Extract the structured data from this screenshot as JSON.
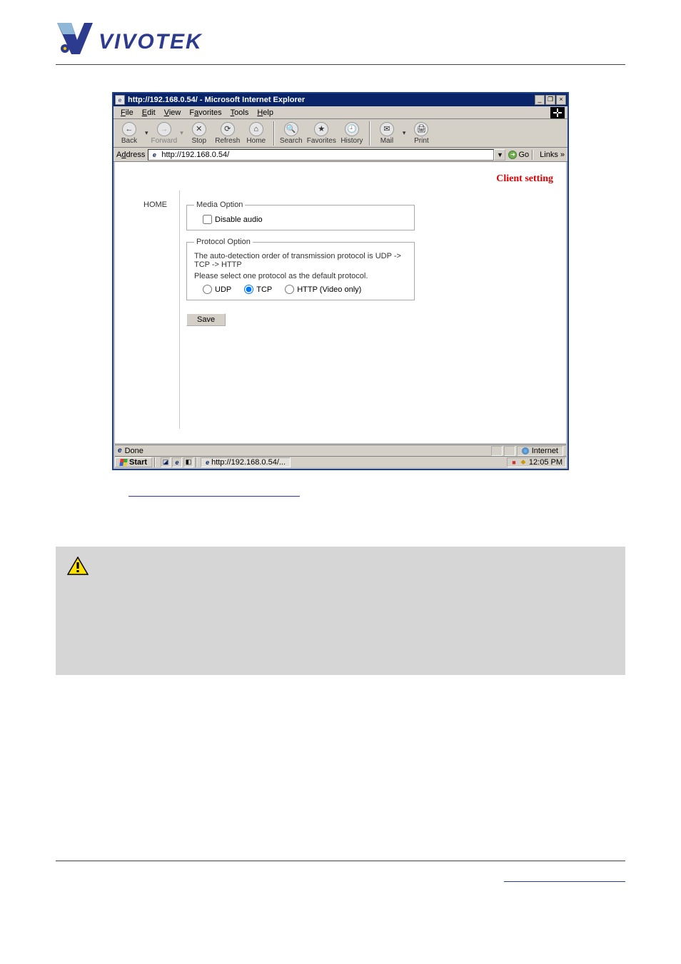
{
  "logo": {
    "text": "VIVOTEK"
  },
  "browser": {
    "title": "http://192.168.0.54/ - Microsoft Internet Explorer",
    "window_controls": {
      "min": "_",
      "max": "❐",
      "close": "×"
    },
    "menus": {
      "file": "File",
      "edit": "Edit",
      "view": "View",
      "favorites": "Favorites",
      "tools": "Tools",
      "help": "Help"
    },
    "toolbar": {
      "back": "Back",
      "forward": "Forward",
      "stop": "Stop",
      "refresh": "Refresh",
      "home": "Home",
      "search": "Search",
      "favorites": "Favorites",
      "history": "History",
      "mail": "Mail",
      "print": "Print"
    },
    "address": {
      "label": "Address",
      "url": "http://192.168.0.54/",
      "go": "Go",
      "links": "Links »"
    },
    "status": {
      "done": "Done",
      "zone": "Internet"
    },
    "taskbar": {
      "start": "Start",
      "task_title": "http://192.168.0.54/...",
      "time": "12:05 PM"
    }
  },
  "page": {
    "title": "Client setting",
    "home": "HOME",
    "media": {
      "legend": "Media Option",
      "disable_audio": "Disable audio"
    },
    "protocol": {
      "legend": "Protocol Option",
      "line1": "The auto-detection order of transmission protocol is UDP -> TCP -> HTTP",
      "line2": "Please select one protocol as the default protocol.",
      "udp": "UDP",
      "tcp": "TCP",
      "http": "HTTP (Video only)"
    },
    "save": "Save"
  }
}
